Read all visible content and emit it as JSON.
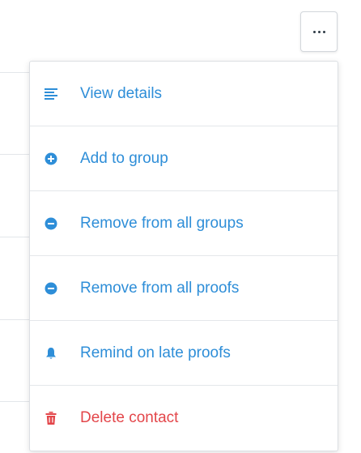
{
  "colors": {
    "accent": "#2e8ed8",
    "danger": "#e3464a",
    "border": "#dcdfe3"
  },
  "more_button": {
    "icon": "more-horizontal-icon"
  },
  "menu": {
    "items": [
      {
        "label": "View details",
        "icon": "list-icon",
        "variant": "default"
      },
      {
        "label": "Add to group",
        "icon": "plus-circle-icon",
        "variant": "default"
      },
      {
        "label": "Remove from all groups",
        "icon": "minus-circle-icon",
        "variant": "default"
      },
      {
        "label": "Remove from all proofs",
        "icon": "minus-circle-icon",
        "variant": "default"
      },
      {
        "label": "Remind on late proofs",
        "icon": "bell-icon",
        "variant": "default"
      },
      {
        "label": "Delete contact",
        "icon": "trash-icon",
        "variant": "danger"
      }
    ]
  }
}
